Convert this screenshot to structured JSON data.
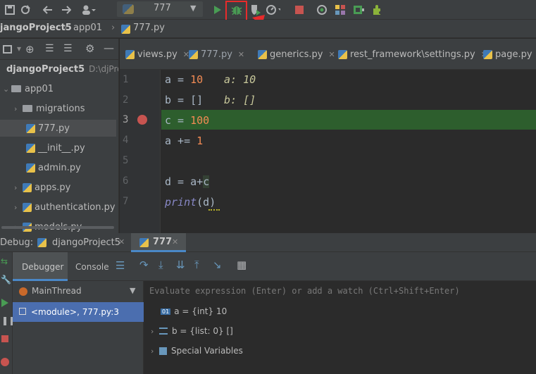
{
  "toolbar": {
    "run_config": "777",
    "icons": [
      "save-icon",
      "sync-icon",
      "back-icon",
      "forward-icon",
      "user-icon",
      "run-icon",
      "debug-icon",
      "coverage-icon",
      "profile-icon",
      "stop-icon"
    ],
    "annotation_color": "#e82b2b"
  },
  "breadcrumb": {
    "project": "jangoProject5",
    "folder": "app01",
    "file": "777.py"
  },
  "project_tree": {
    "root_label": "djangoProject5",
    "root_path": "D:\\djPro",
    "items": [
      {
        "label": "app01"
      },
      {
        "label": "migrations"
      },
      {
        "label": "777.py"
      },
      {
        "label": "__init__.py"
      },
      {
        "label": "admin.py"
      },
      {
        "label": "apps.py"
      },
      {
        "label": "authentication.py"
      },
      {
        "label": "models.py"
      }
    ]
  },
  "editor_tabs": [
    "views.py",
    "777.py",
    "generics.py",
    "rest_framework\\settings.py",
    "page.py"
  ],
  "code": {
    "lines": [
      "1",
      "2",
      "3",
      "4",
      "5",
      "6",
      "7"
    ],
    "l1_var": "a",
    "l1_eq": " = ",
    "l1_val": "10",
    "l1_inline": "a: 10",
    "l2_var": "b",
    "l2_eq": " = ",
    "l2_val": "[]",
    "l2_inline": "b: []",
    "l3_var": "c",
    "l3_eq": " = ",
    "l3_val": "100",
    "l4_var": "a",
    "l4_eq": " += ",
    "l4_val": "1",
    "l6_text": "d = a+",
    "l6_c": "c",
    "l7_func": "print",
    "l7_args": "(d)"
  },
  "debug": {
    "label": "Debug:",
    "session_tab": "djangoProject5",
    "run_tab": "777",
    "tab_debugger": "Debugger",
    "tab_console": "Console",
    "thread": "MainThread",
    "frame": "<module>, 777.py:3",
    "eval_placeholder": "Evaluate expression (Enter) or add a watch (Ctrl+Shift+Enter)",
    "vars": [
      {
        "badge": "01",
        "text": "a = {int} 10"
      },
      {
        "text": "b = {list: 0} []"
      },
      {
        "text": "Special Variables"
      }
    ]
  }
}
